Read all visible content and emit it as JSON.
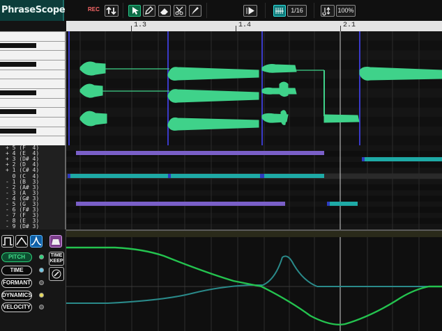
{
  "app": {
    "title": "PhraseScope"
  },
  "toolbar": {
    "rec_label": "REC",
    "tools": [
      {
        "name": "updown-arrow-icon",
        "active": false
      },
      {
        "name": "pointer-icon",
        "active": true
      },
      {
        "name": "pencil-icon",
        "active": false
      },
      {
        "name": "eraser-icon",
        "active": false
      },
      {
        "name": "scissors-icon",
        "active": false
      },
      {
        "name": "brush-icon",
        "active": false
      }
    ],
    "snap_label": "1/16",
    "zoom_label": "100%"
  },
  "ruler": {
    "markers": [
      "1.3",
      "1.4",
      "2.1"
    ]
  },
  "offsets": [
    "+ 5 (F  4)",
    "+ 4 (E  4)",
    "+ 3 (D# 4)",
    "+ 2 (D  4)",
    "+ 1 (C# 4)",
    "  0 (C  4)",
    "- 1 (B  3)",
    "- 2 (A# 3)",
    "- 3 (A  3)",
    "- 4 (G# 3)",
    "- 5 (G  3)",
    "- 6 (F# 3)",
    "- 7 (F  3)",
    "- 8 (E  3)",
    "- 9 (D# 3)"
  ],
  "params": {
    "pitch": "PITCH",
    "time": "TIME",
    "formant": "FORMANT",
    "dynamics": "DYNAMICS",
    "velocity": "VELOCITY",
    "timekeep": "TIME KEEP"
  },
  "colors": {
    "accent": "#2ed27a",
    "wave": "#3fd28a",
    "purple_bar": "#7a5fc8",
    "teal_bar": "#1eaaa6",
    "curve_green": "#24c34f",
    "curve_teal": "#2a8a8a"
  }
}
